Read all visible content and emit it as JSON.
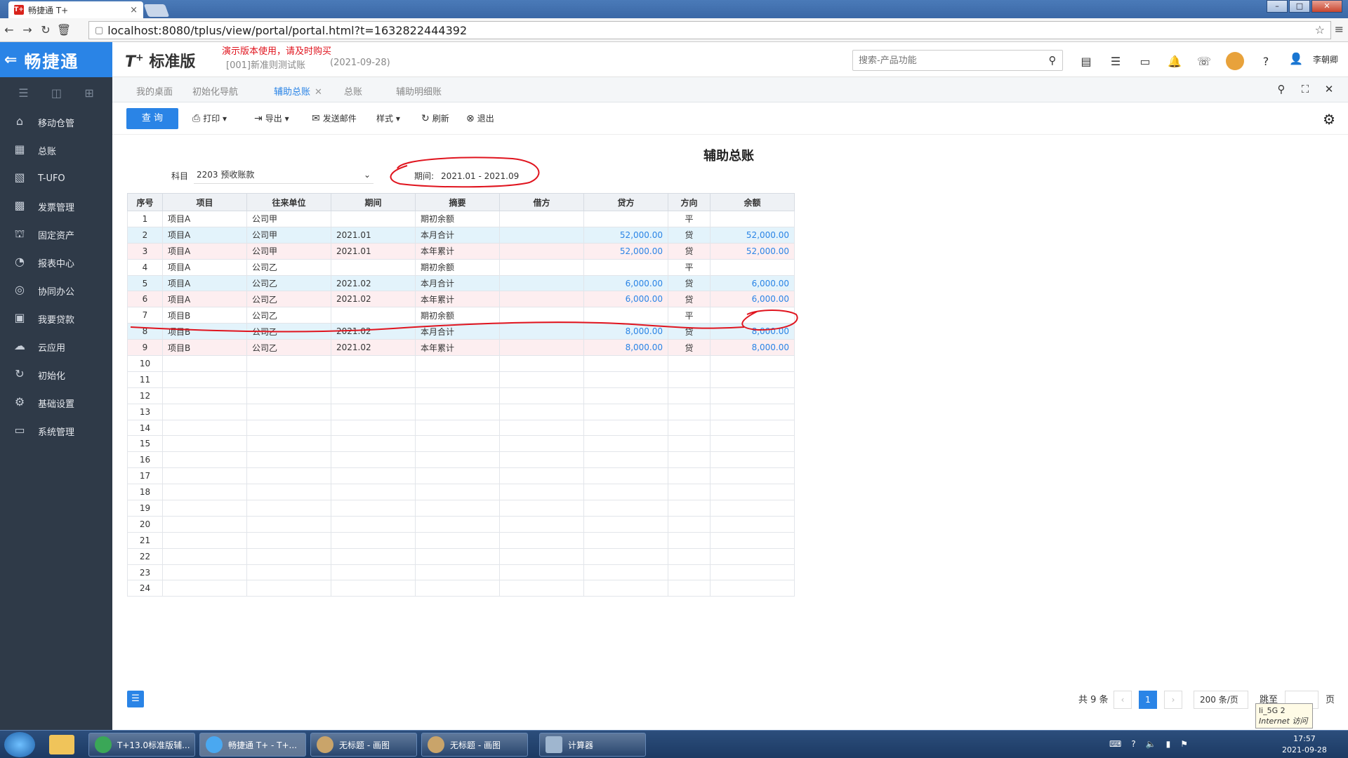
{
  "browser": {
    "tab_title": "畅捷通 T+",
    "tab_favicon": "T+",
    "close": "×",
    "url": "localhost:8080/tplus/view/portal/portal.html?t=1632822444392",
    "win_min": "–",
    "win_max": "□",
    "win_close": "✕"
  },
  "app": {
    "brand": "畅捷通",
    "product": "T",
    "product_sup": "+",
    "edition": "标准版",
    "demo_notice": "演示版本使用，请及时购买",
    "account": "[001]新准则测试账",
    "account_date": "(2021-09-28)",
    "search_placeholder": "搜索-产品功能",
    "user": "李朝卿"
  },
  "sidebar": {
    "items": [
      {
        "label": "移动仓管",
        "icon": "warehouse-icon"
      },
      {
        "label": "总账",
        "icon": "ledger-icon"
      },
      {
        "label": "T-UFO",
        "icon": "ufo-icon"
      },
      {
        "label": "发票管理",
        "icon": "invoice-icon"
      },
      {
        "label": "固定资产",
        "icon": "bank-icon"
      },
      {
        "label": "报表中心",
        "icon": "chart-icon"
      },
      {
        "label": "协同办公",
        "icon": "collab-icon"
      },
      {
        "label": "我要贷款",
        "icon": "money-icon"
      },
      {
        "label": "云应用",
        "icon": "cloud-icon"
      },
      {
        "label": "初始化",
        "icon": "refresh-icon"
      },
      {
        "label": "基础设置",
        "icon": "settings-icon"
      },
      {
        "label": "系统管理",
        "icon": "monitor-icon"
      }
    ]
  },
  "tabs": [
    {
      "label": "我的桌面"
    },
    {
      "label": "初始化导航"
    },
    {
      "label": "辅助总账",
      "active": true
    },
    {
      "label": "总账"
    },
    {
      "label": "辅助明细账"
    }
  ],
  "toolbar": {
    "query": "查 询",
    "print": "打印",
    "export": "导出",
    "send_mail": "发送邮件",
    "style": "样式",
    "refresh": "刷新",
    "exit": "退出"
  },
  "report": {
    "title": "辅助总账",
    "subject_label": "科目",
    "subject_value": "2203 预收账款",
    "period_label": "期间:",
    "period_value": "2021.01 - 2021.09",
    "columns": [
      "序号",
      "项目",
      "往来单位",
      "期间",
      "摘要",
      "借方",
      "贷方",
      "方向",
      "余额"
    ],
    "rows": [
      {
        "seq": "1",
        "item": "项目A",
        "party": "公司甲",
        "period": "",
        "summary": "期初余额",
        "debit": "",
        "credit": "",
        "dir": "平",
        "balance": ""
      },
      {
        "seq": "2",
        "item": "项目A",
        "party": "公司甲",
        "period": "2021.01",
        "summary": "本月合计",
        "debit": "",
        "credit": "52,000.00",
        "dir": "贷",
        "balance": "52,000.00"
      },
      {
        "seq": "3",
        "item": "项目A",
        "party": "公司甲",
        "period": "2021.01",
        "summary": "本年累计",
        "debit": "",
        "credit": "52,000.00",
        "dir": "贷",
        "balance": "52,000.00"
      },
      {
        "seq": "4",
        "item": "项目A",
        "party": "公司乙",
        "period": "",
        "summary": "期初余额",
        "debit": "",
        "credit": "",
        "dir": "平",
        "balance": ""
      },
      {
        "seq": "5",
        "item": "项目A",
        "party": "公司乙",
        "period": "2021.02",
        "summary": "本月合计",
        "debit": "",
        "credit": "6,000.00",
        "dir": "贷",
        "balance": "6,000.00"
      },
      {
        "seq": "6",
        "item": "项目A",
        "party": "公司乙",
        "period": "2021.02",
        "summary": "本年累计",
        "debit": "",
        "credit": "6,000.00",
        "dir": "贷",
        "balance": "6,000.00"
      },
      {
        "seq": "7",
        "item": "项目B",
        "party": "公司乙",
        "period": "",
        "summary": "期初余额",
        "debit": "",
        "credit": "",
        "dir": "平",
        "balance": ""
      },
      {
        "seq": "8",
        "item": "项目B",
        "party": "公司乙",
        "period": "2021.02",
        "summary": "本月合计",
        "debit": "",
        "credit": "8,000.00",
        "dir": "贷",
        "balance": "8,000.00"
      },
      {
        "seq": "9",
        "item": "项目B",
        "party": "公司乙",
        "period": "2021.02",
        "summary": "本年累计",
        "debit": "",
        "credit": "8,000.00",
        "dir": "贷",
        "balance": "8,000.00"
      }
    ],
    "empty_rows": [
      "10",
      "11",
      "12",
      "13",
      "14",
      "15",
      "16",
      "17",
      "18",
      "19",
      "20",
      "21",
      "22",
      "23",
      "24"
    ]
  },
  "pager": {
    "total": "共 9 条",
    "prev": "‹",
    "current": "1",
    "next": "›",
    "page_size": "200 条/页",
    "jump_label": "跳至",
    "page_unit": "页"
  },
  "tooltip": {
    "line1": "li_5G  2",
    "line2": "Internet 访问"
  },
  "taskbar": {
    "items": [
      {
        "label": "T+13.0标准版辅..."
      },
      {
        "label": "畅捷通 T+ - T+..."
      },
      {
        "label": "无标题 - 画图"
      },
      {
        "label": "无标题 - 画图"
      },
      {
        "label": "计算器"
      }
    ],
    "time": "17:57",
    "date": "2021-09-28"
  },
  "colors": {
    "accent": "#2a84e6",
    "sidebar_bg": "#2f3a48",
    "annotation": "#e0141e"
  }
}
